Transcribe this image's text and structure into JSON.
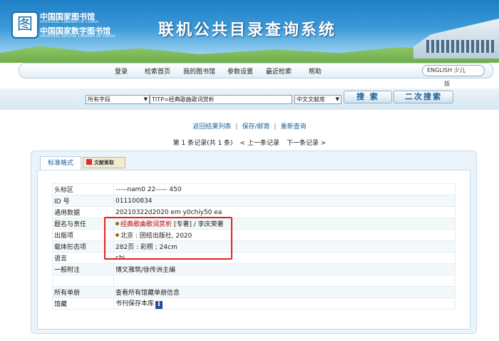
{
  "header": {
    "logo_glyph": "图",
    "logo_line1": "中国国家图书馆",
    "logo_line1_en": "NATIONAL LIBRARY OF CHINA",
    "logo_line2": "中国国家数字图书馆",
    "logo_line2_en": "NATIONAL DIGITAL LIBRARY OF CHINA",
    "system_title": "联机公共目录查询系统"
  },
  "nav": {
    "items": [
      "登录",
      "检索首页",
      "我的图书馆",
      "参数设置",
      "最近检索",
      "帮助"
    ],
    "language": "ENGLISH 少儿",
    "language_sub": "版"
  },
  "search": {
    "field": "所有字段",
    "query": "TITP=经典歌曲歌词赏析",
    "database": "中文文献库",
    "search_button": "搜 索",
    "secondary_button": "二次搜索"
  },
  "links": {
    "back": "返回结果列表",
    "save": "保存/邮寄",
    "requery": "重新查询"
  },
  "pager": {
    "record": "第 1 条记录(共 1 条)",
    "prev": "< 上一条记录",
    "next": "下一条记录 >"
  },
  "tabs": {
    "standard": "标准格式",
    "doc": "文献索取"
  },
  "record": {
    "rows": [
      {
        "label": "头标区",
        "value": "-----nam0 22----- 450"
      },
      {
        "label": "ID 号",
        "value": "011100834"
      },
      {
        "label": "通用数据",
        "value": "20210322d2020 em y0chiy50 ea"
      },
      {
        "label": "题名与责任",
        "title": "经典歌曲歌词赏析",
        "rest": " [专著] / 李庆荣著"
      },
      {
        "label": "出版项",
        "value": "北京 : 团结出版社, 2020"
      },
      {
        "label": "载体形态项",
        "value": "282页 : 彩照 ; 24cm"
      },
      {
        "label": "语言",
        "value": "chi"
      },
      {
        "label": "一般附注",
        "value": "博文雅筑/徐传洲主编"
      },
      {
        "label": "",
        "value": ""
      },
      {
        "label": "所有单册",
        "value": "查看所有馆藏单册信息"
      },
      {
        "label": "馆藏",
        "value": "书刊保存本库"
      }
    ]
  }
}
